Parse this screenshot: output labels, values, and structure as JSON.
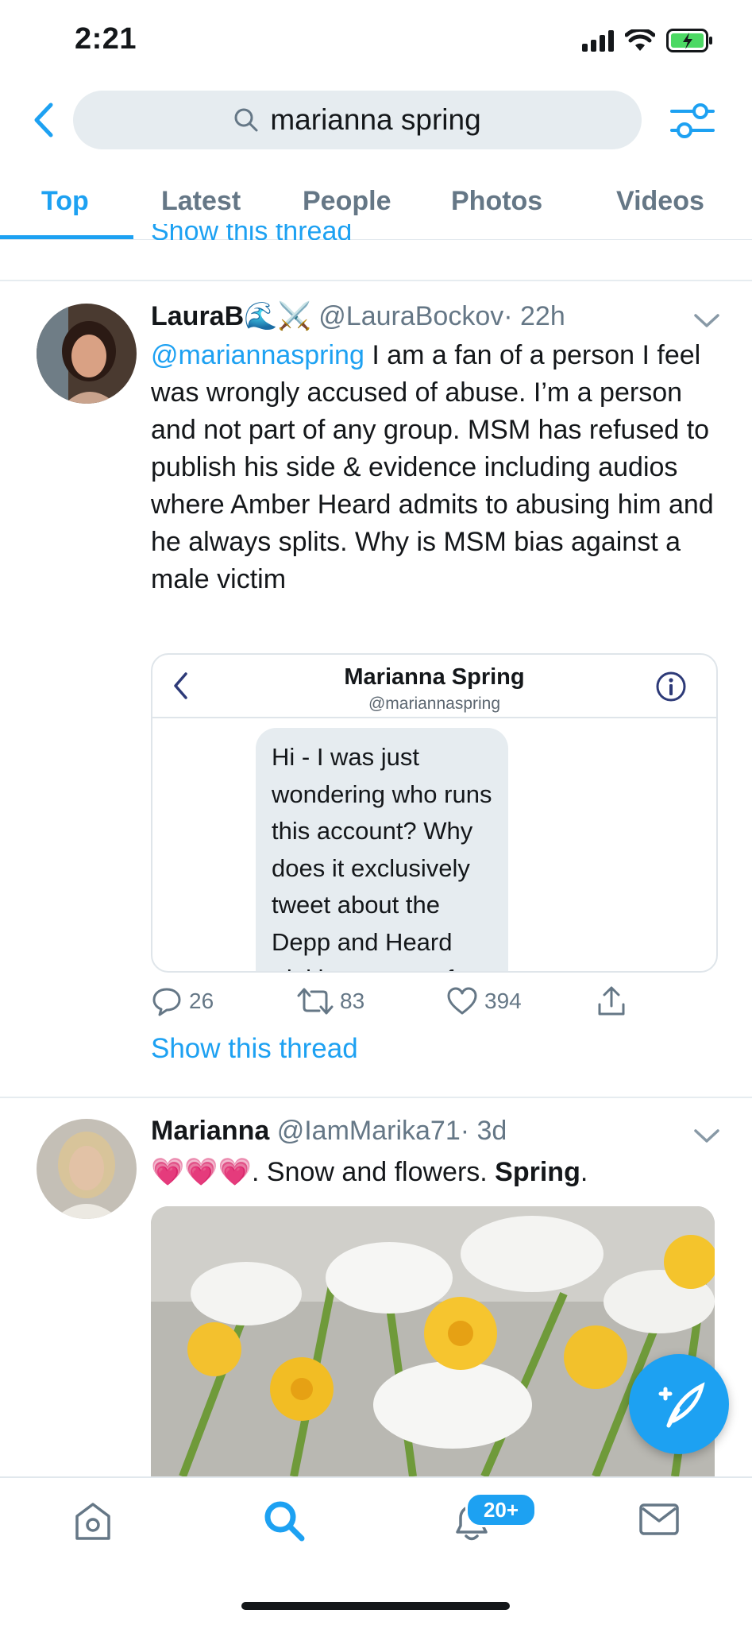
{
  "status_bar": {
    "time": "2:21"
  },
  "search": {
    "query": "marianna spring"
  },
  "tabs": [
    {
      "label": "Top",
      "active": true
    },
    {
      "label": "Latest"
    },
    {
      "label": "People"
    },
    {
      "label": "Photos"
    },
    {
      "label": "Videos"
    }
  ],
  "clipped_link": "Show this thread",
  "tweets": [
    {
      "name": "LauraB🌊⚔️",
      "handle": "@LauraBockov",
      "time": "· 22h",
      "mention": "@mariannaspring",
      "text": " I am a fan of a person I feel was wrongly accused of abuse. I’m a person and not part of any group. MSM has refused to publish his side & evidence including audios where Amber Heard admits to abusing him and he always splits. Why is MSM bias against a male victim",
      "embed": {
        "name": "Marianna Spring",
        "handle": "@mariannaspring",
        "message": "Hi  - I was just wondering who runs this account? Why does it exclusively tweet about the Depp and Heard trial in support of Depp? Are you just a genuine Depp fan? I'm"
      },
      "replies": "26",
      "retweets": "83",
      "likes": "394",
      "show_thread": "Show this thread"
    },
    {
      "name": "Marianna",
      "handle": "@IamMarika71",
      "time": "· 3d",
      "emoji": "💗💗💗",
      "text_before": ". Snow and flowers. ",
      "text_bold": "Spring",
      "text_after": "."
    }
  ],
  "nav": {
    "notifications_badge": "20+"
  },
  "colors": {
    "accent": "#1da1f2",
    "secondary_text": "#657786",
    "background": "#ffffff"
  }
}
